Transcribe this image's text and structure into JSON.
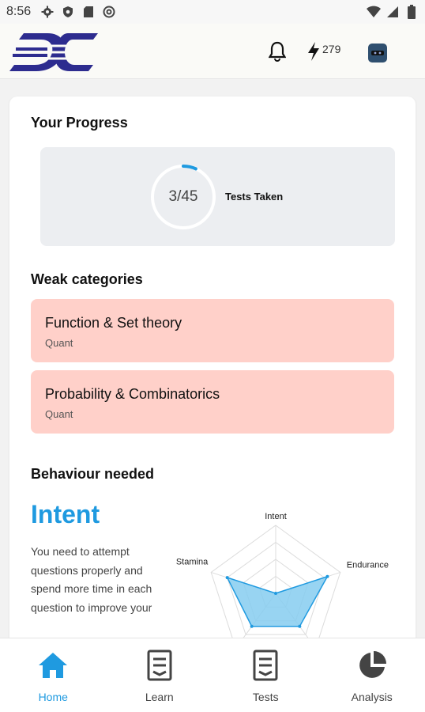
{
  "status_bar": {
    "time": "8:56",
    "icons": [
      "gear-icon",
      "shield-icon",
      "sd-card-icon",
      "at-icon"
    ],
    "right_icons": [
      "wifi-icon",
      "cell-signal-icon",
      "battery-icon"
    ]
  },
  "header": {
    "logo": "DE",
    "energy_count": "279",
    "accent": "#2d2c8f"
  },
  "progress": {
    "title": "Your Progress",
    "tests_value": "3/45",
    "tests_fraction": 0.0667,
    "tests_label": "Tests Taken"
  },
  "weak": {
    "title": "Weak categories",
    "items": [
      {
        "name": "Function & Set theory",
        "category": "Quant"
      },
      {
        "name": "Probability & Combinatorics",
        "category": "Quant"
      }
    ],
    "color": "#ffd0c9"
  },
  "behaviour": {
    "title": "Behaviour needed",
    "focus": "Intent",
    "description": "You need to attempt questions properly and spend more time in each question to improve your",
    "radar": {
      "axes": [
        "Intent",
        "Endurance",
        "",
        "",
        "Stamina"
      ],
      "values": [
        0.0,
        0.8,
        0.6,
        0.6,
        0.75
      ]
    }
  },
  "bottom_nav": [
    {
      "label": "Home",
      "icon": "home-icon",
      "active": true
    },
    {
      "label": "Learn",
      "icon": "learn-icon",
      "active": false
    },
    {
      "label": "Tests",
      "icon": "tests-icon",
      "active": false
    },
    {
      "label": "Analysis",
      "icon": "pie-chart-icon",
      "active": false
    }
  ],
  "colors": {
    "accent_blue": "#1f9ae0",
    "radar_fill": "#86cdf0"
  }
}
